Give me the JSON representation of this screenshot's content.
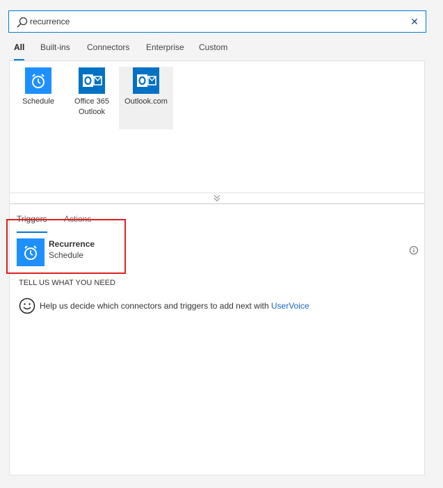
{
  "search": {
    "value": "recurrence",
    "clear_icon": "close-icon"
  },
  "filters": [
    {
      "label": "All",
      "active": true
    },
    {
      "label": "Built-ins"
    },
    {
      "label": "Connectors"
    },
    {
      "label": "Enterprise"
    },
    {
      "label": "Custom"
    }
  ],
  "connectors": [
    {
      "label": "Schedule",
      "icon": "alarm-clock-icon"
    },
    {
      "label": "Office 365\nOutlook",
      "icon": "outlook-icon"
    },
    {
      "label": "Outlook.com",
      "icon": "outlook-icon",
      "selected": true
    }
  ],
  "result_tabs": [
    {
      "label": "Triggers",
      "active": true
    },
    {
      "label": "Actions"
    }
  ],
  "trigger": {
    "name": "Recurrence",
    "connector": "Schedule"
  },
  "feedback": {
    "heading": "TELL US WHAT YOU NEED",
    "text": "Help us decide which connectors and triggers to add next with ",
    "link": "UserVoice"
  },
  "colors": {
    "accent": "#0078d4",
    "schedule_blue": "#1e8fff",
    "outlook_blue": "#0072c6",
    "highlight": "#e02020"
  }
}
